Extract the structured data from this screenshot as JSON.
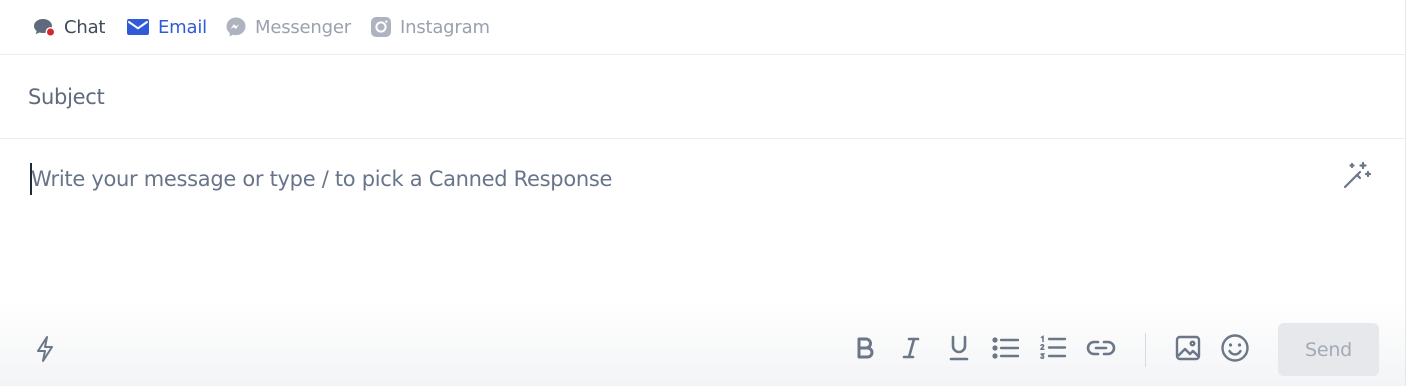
{
  "channel_tabs": [
    {
      "label": "Chat",
      "icon": "chat-bubble-icon",
      "state": "default",
      "color": "#3f4a5a",
      "has_notification_dot": true,
      "dot_color": "#d9262c"
    },
    {
      "label": "Email",
      "icon": "envelope-icon",
      "state": "active",
      "color": "#2f5bd8"
    },
    {
      "label": "Messenger",
      "icon": "messenger-icon",
      "state": "disabled",
      "color": "#9aa1ad"
    },
    {
      "label": "Instagram",
      "icon": "instagram-icon",
      "state": "disabled",
      "color": "#9aa1ad"
    }
  ],
  "subject": {
    "placeholder": "Subject",
    "value": ""
  },
  "message": {
    "placeholder": "Write your message or type / to pick a Canned Response",
    "value": "",
    "ai_icon": "magic-wand-icon"
  },
  "toolbar": {
    "shortcuts_icon": "lightning-bolt-icon",
    "formatting": [
      {
        "name": "bold",
        "icon": "bold-icon"
      },
      {
        "name": "italic",
        "icon": "italic-icon"
      },
      {
        "name": "underline",
        "icon": "underline-icon"
      },
      {
        "name": "bulleted-list",
        "icon": "bulleted-list-icon"
      },
      {
        "name": "numbered-list",
        "icon": "numbered-list-icon"
      },
      {
        "name": "link",
        "icon": "link-icon"
      }
    ],
    "attachments": [
      {
        "name": "image",
        "icon": "image-icon"
      },
      {
        "name": "emoji",
        "icon": "emoji-icon"
      }
    ],
    "send_label": "Send",
    "send_enabled": false
  },
  "colors": {
    "accent": "#2f5bd8",
    "icon_gray": "#6b7686",
    "disabled_text": "#a3aab6",
    "send_bg": "#e6e8eb"
  }
}
